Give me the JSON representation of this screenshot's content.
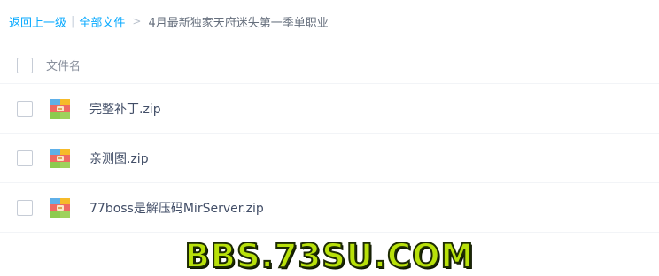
{
  "breadcrumb": {
    "back_label": "返回上一级",
    "separator": "|",
    "root_label": "全部文件",
    "arrow": ">",
    "current_folder": "4月最新独家天府迷失第一季单职业"
  },
  "list": {
    "header_label": "文件名",
    "files": [
      {
        "name": "完整补丁.zip",
        "icon": "zip-archive-icon"
      },
      {
        "name": "亲测图.zip",
        "icon": "zip-archive-icon"
      },
      {
        "name": "77boss是解压码MirServer.zip",
        "icon": "zip-archive-icon"
      }
    ]
  },
  "watermark": {
    "text": "BBS.73SU.COM"
  },
  "colors": {
    "link": "#09aaff",
    "text": "#424e67",
    "watermark_fill": "#b8e10a"
  }
}
